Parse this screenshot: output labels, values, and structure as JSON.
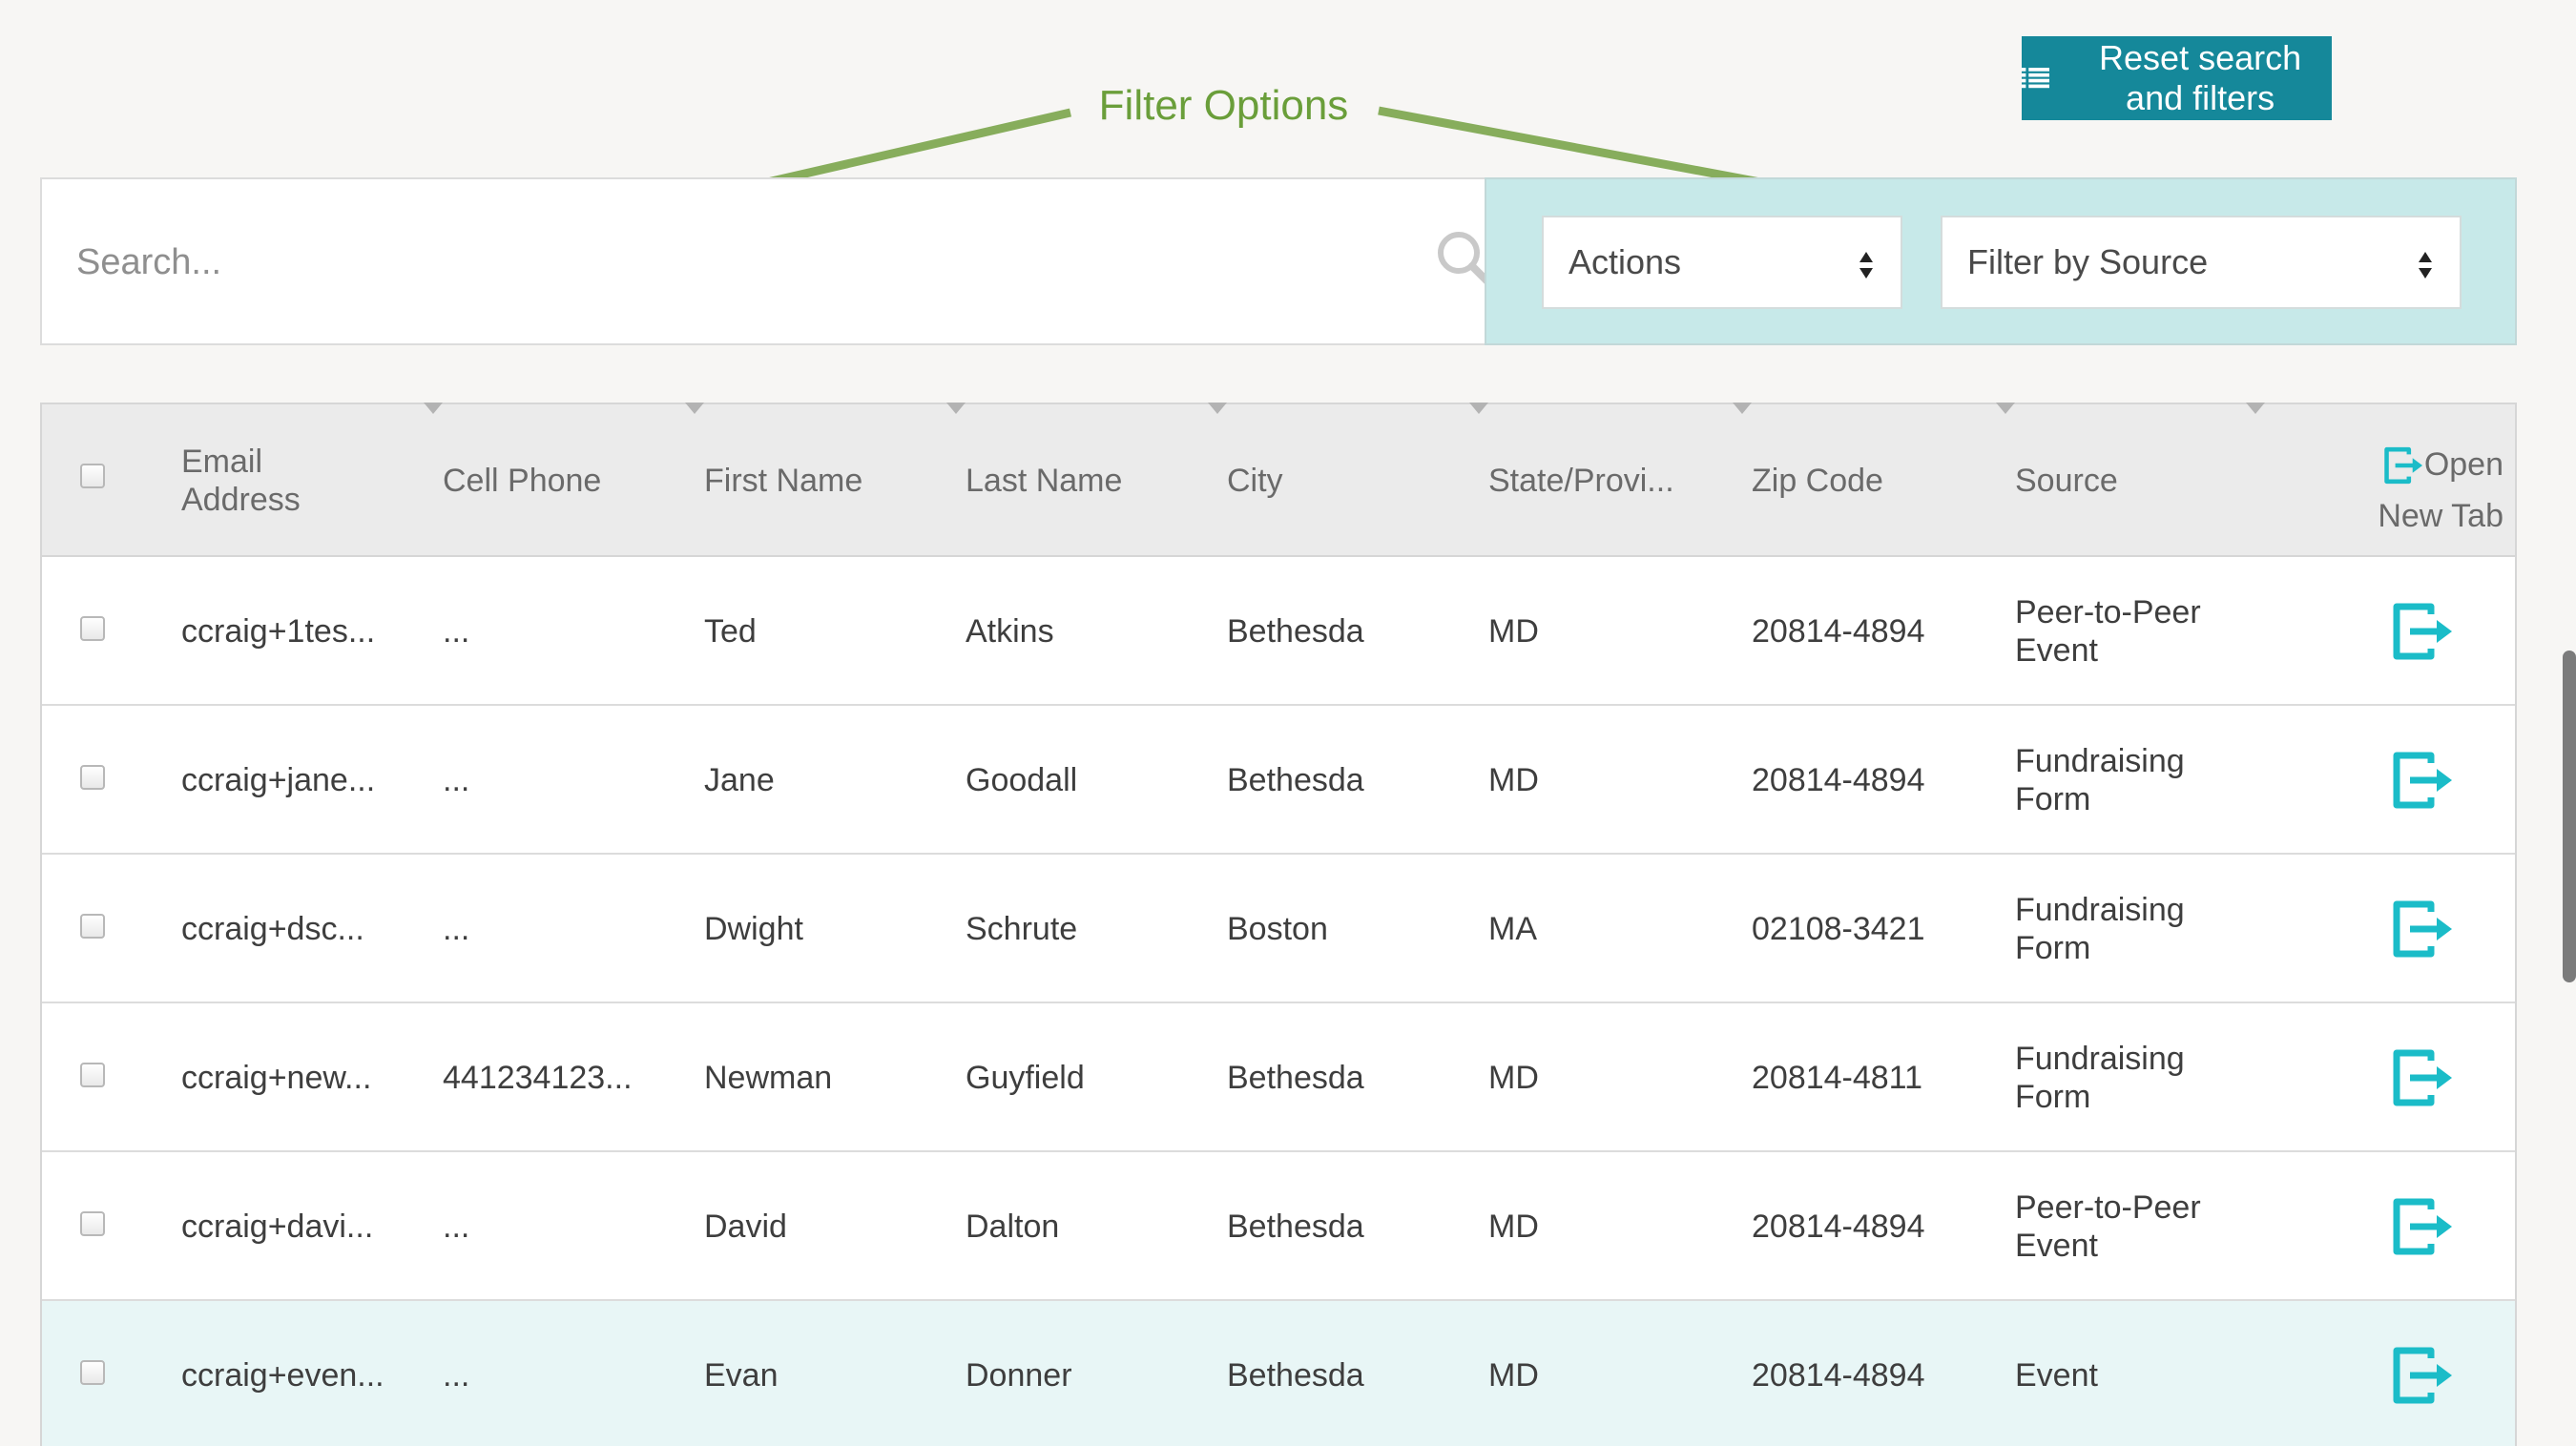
{
  "toolbar": {
    "reset_label": "Reset search and filters"
  },
  "annotation": {
    "label": "Filter Options"
  },
  "search": {
    "placeholder": "Search..."
  },
  "filters": {
    "actions_label": "Actions",
    "source_label": "Filter by Source"
  },
  "table": {
    "columns": [
      "Email Address",
      "Cell Phone",
      "First Name",
      "Last Name",
      "City",
      "State/Provi...",
      "Zip Code",
      "Source"
    ],
    "open_header": {
      "line1": "Open",
      "line2": "New Tab"
    },
    "rows": [
      {
        "email": "ccraig+1tes...",
        "phone": "...",
        "first": "Ted",
        "last": "Atkins",
        "city": "Bethesda",
        "state": "MD",
        "zip": "20814-4894",
        "source": "Peer-to-Peer Event"
      },
      {
        "email": "ccraig+jane...",
        "phone": "...",
        "first": "Jane",
        "last": "Goodall",
        "city": "Bethesda",
        "state": "MD",
        "zip": "20814-4894",
        "source": "Fundraising Form"
      },
      {
        "email": "ccraig+dsc...",
        "phone": "...",
        "first": "Dwight",
        "last": "Schrute",
        "city": "Boston",
        "state": "MA",
        "zip": "02108-3421",
        "source": "Fundraising Form"
      },
      {
        "email": "ccraig+new...",
        "phone": "441234123...",
        "first": "Newman",
        "last": "Guyfield",
        "city": "Bethesda",
        "state": "MD",
        "zip": "20814-4811",
        "source": "Fundraising Form"
      },
      {
        "email": "ccraig+davi...",
        "phone": "...",
        "first": "David",
        "last": "Dalton",
        "city": "Bethesda",
        "state": "MD",
        "zip": "20814-4894",
        "source": "Peer-to-Peer Event"
      },
      {
        "email": "ccraig+even...",
        "phone": "...",
        "first": "Evan",
        "last": "Donner",
        "city": "Bethesda",
        "state": "MD",
        "zip": "20814-4894",
        "source": "Event"
      }
    ]
  },
  "icons": {
    "reset": "list-icon",
    "search": "search-icon",
    "select": "updown-icon",
    "open": "open-new-tab-icon"
  },
  "colors": {
    "accent": "#15889a",
    "open_icon": "#1bbcc8",
    "annotation": "#6a9e3a",
    "filter_bg": "#c7e9e9",
    "highlight_row": "#e8f6f6"
  }
}
